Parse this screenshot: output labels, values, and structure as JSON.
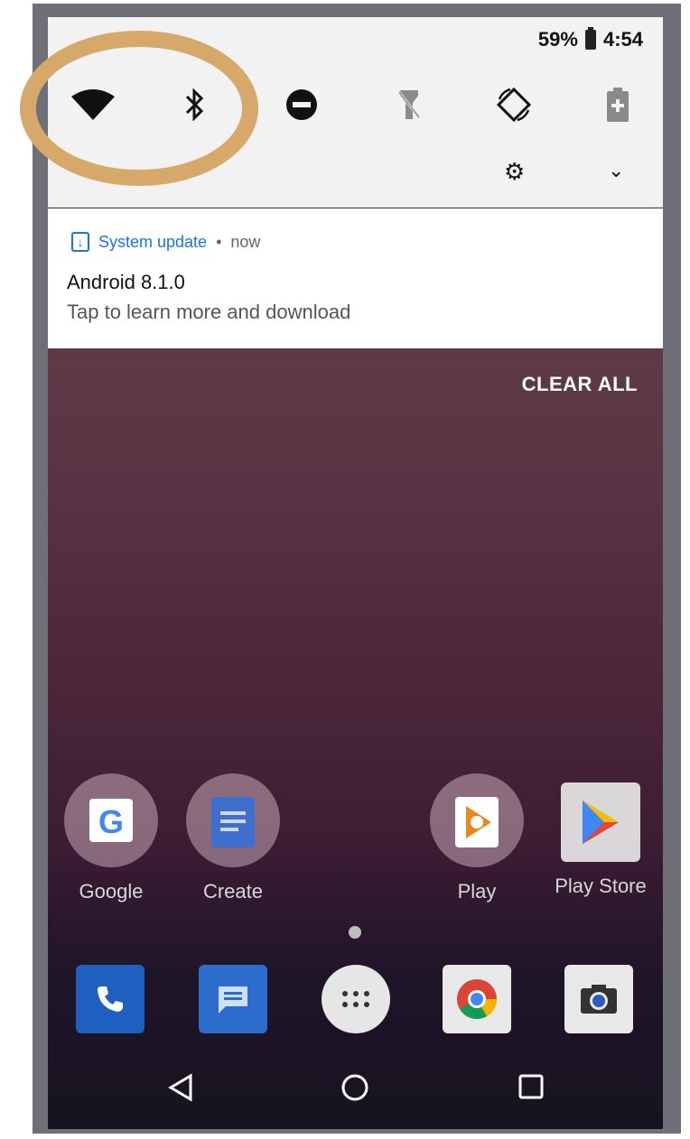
{
  "status_bar": {
    "battery_percent": "59%",
    "time": "4:54"
  },
  "quick_settings": {
    "tiles": [
      "wifi-icon",
      "bluetooth-icon",
      "do-not-disturb-icon",
      "flashlight-icon",
      "auto-rotate-icon",
      "battery-saver-icon"
    ]
  },
  "notification": {
    "app": "System update",
    "separator": "•",
    "time": "now",
    "title": "Android 8.1.0",
    "body": "Tap to learn more and download"
  },
  "clear_all": "CLEAR ALL",
  "home_apps": [
    {
      "label": "Google"
    },
    {
      "label": "Create"
    },
    {
      "label": "Play"
    },
    {
      "label": "Play Store"
    }
  ],
  "dock": [
    "phone-icon",
    "messages-icon",
    "app-drawer-icon",
    "chrome-icon",
    "camera-icon"
  ],
  "nav": [
    "back-icon",
    "home-icon",
    "recents-icon"
  ],
  "colors": {
    "accent": "#1a73e8",
    "highlight": "#d6a86a"
  }
}
